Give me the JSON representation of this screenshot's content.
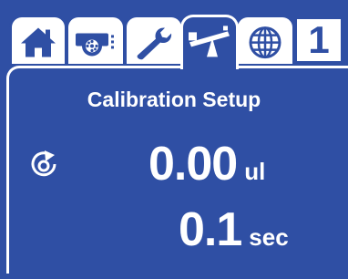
{
  "tabs": [
    {
      "name": "home-icon"
    },
    {
      "name": "pump-head-icon"
    },
    {
      "name": "wrench-icon"
    },
    {
      "name": "calibration-scale-icon",
      "active": true
    },
    {
      "name": "globe-icon"
    }
  ],
  "page_number": "1",
  "screen": {
    "title": "Calibration Setup",
    "volume": {
      "value": "0.00",
      "unit": "ul"
    },
    "time": {
      "value": "0.1",
      "unit": "sec"
    }
  },
  "colors": {
    "background": "#2f4fa4",
    "foreground": "#ffffff"
  }
}
